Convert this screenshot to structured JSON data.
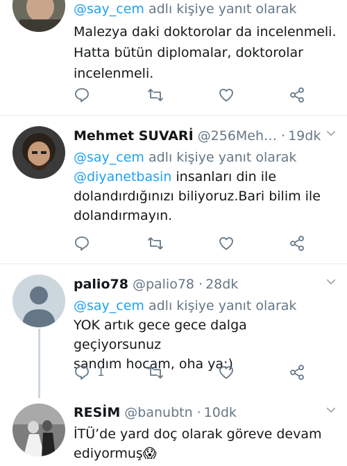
{
  "colors": {
    "accent": "#1da1f2",
    "muted": "#657786",
    "text": "#14171a",
    "divider": "#e6ecf0"
  },
  "tweets": [
    {
      "name": "",
      "handle": "",
      "time": "",
      "reply_prefix": "@say_cem",
      "reply_suffix": " adlı kişiye yanıt olarak",
      "lines": [
        "Malezya daki doktorolar da incelenmeli.",
        "Hatta bütün diplomalar, doktorolar",
        "incelenmeli."
      ],
      "reply_count": "",
      "icons": [
        "reply-icon",
        "retweet-icon",
        "like-icon",
        "share-icon"
      ]
    },
    {
      "name": "Mehmet SUVARİ",
      "handle": "@256Meh…",
      "sep": "·",
      "time": "19dk",
      "reply_prefix": "@say_cem",
      "reply_suffix": " adlı kişiye yanıt olarak",
      "mention": "@diyanetbasin",
      "line1_rest": " insanları din ile",
      "lines": [
        "dolandırdığınızı biliyoruz.Bari bilim ile",
        "dolandırmayın."
      ],
      "reply_count": "",
      "icons": [
        "reply-icon",
        "retweet-icon",
        "like-icon",
        "share-icon"
      ]
    },
    {
      "name": "palio78",
      "handle": "@palio78",
      "sep": "·",
      "time": "28dk",
      "reply_prefix": "@say_cem",
      "reply_suffix": " adlı kişiye yanıt olarak",
      "lines": [
        "YOK artık gece gece dalga geçiyorsunuz",
        "sandım hocam, oha ya:)"
      ],
      "reply_count": "1",
      "icons": [
        "reply-icon",
        "retweet-icon",
        "like-icon",
        "share-icon"
      ]
    },
    {
      "name": "RESİM",
      "handle": "@banubtn",
      "sep": "·",
      "time": "10dk",
      "lines": [
        "İTÜ’de yard doç olarak göreve devam",
        "ediyormuş😱"
      ]
    }
  ]
}
